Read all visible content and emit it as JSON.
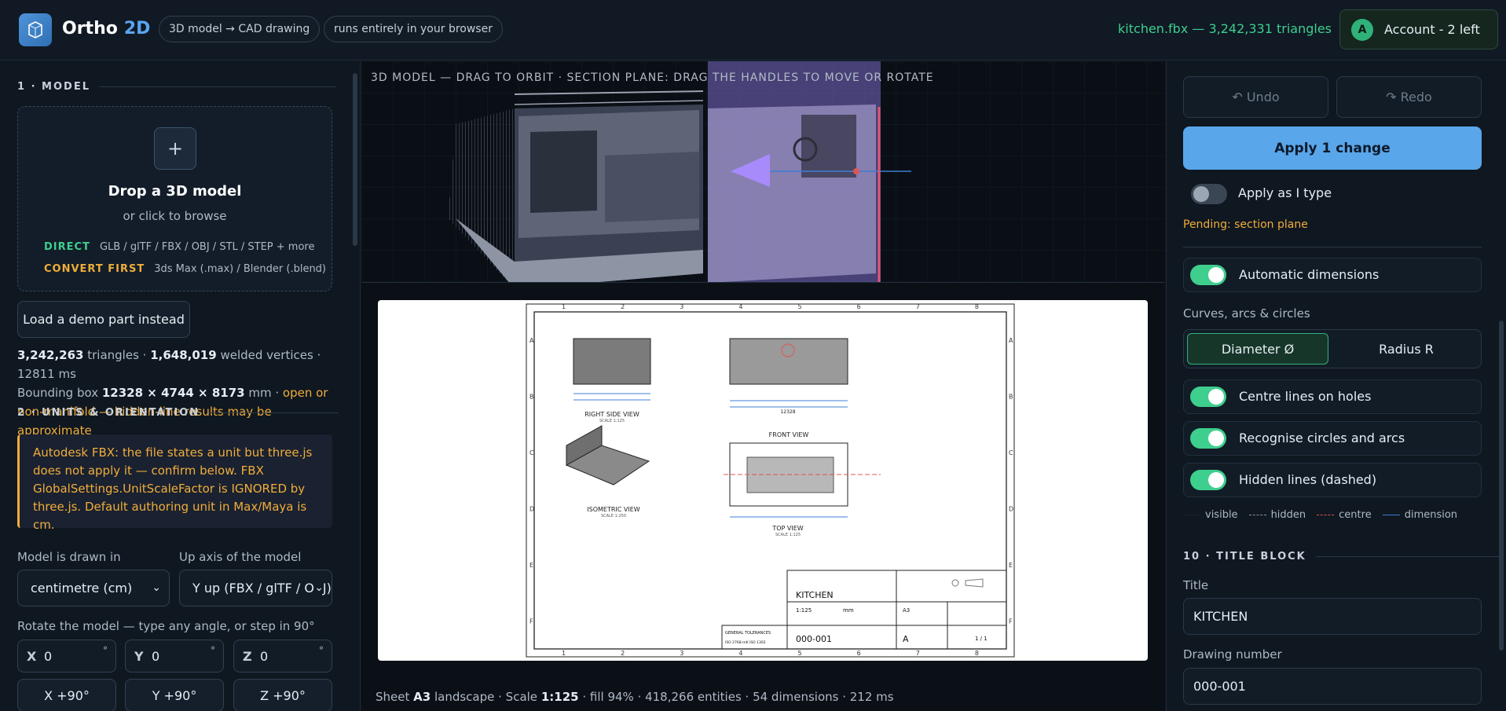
{
  "header": {
    "brand_name": "Ortho",
    "brand_accent": "2D",
    "pill_1": "3D model → CAD drawing",
    "pill_2": "runs entirely in your browser",
    "file_info": "kitchen.fbx — 3,242,331 triangles",
    "account_initial": "A",
    "account_label": "Account - 2 left"
  },
  "model": {
    "section_title": "1 · MODEL",
    "drop_plus": "+",
    "drop_title": "Drop a 3D model",
    "drop_sub": "or click to browse",
    "direct_key": "DIRECT",
    "direct_formats": "GLB / glTF / FBX / OBJ / STL / STEP + more",
    "convert_key": "CONVERT FIRST",
    "convert_formats": "3ds Max (.max) / Blender (.blend)",
    "demo_button": "Load a demo part instead",
    "stats": {
      "triangles": "3,242,263",
      "triangles_label": "triangles ·",
      "vertices": "1,648,019",
      "vertices_label": "welded vertices · 12811 ms",
      "bbox_label": "Bounding box",
      "bbox": "12328 × 4744 × 8173",
      "bbox_unit": "mm ·",
      "warning": "open or non-manifold — hidden-line results may be approximate"
    }
  },
  "units": {
    "section_title": "2 · UNITS & ORIENTATION",
    "notice": "Autodesk FBX: the file states a unit but three.js does not apply it — confirm below. FBX GlobalSettings.UnitScaleFactor is IGNORED by three.js. Default authoring unit in Max/Maya is cm.",
    "drawn_in_label": "Model is drawn in",
    "drawn_in_value": "centimetre (cm)",
    "up_axis_label": "Up axis of the model",
    "up_axis_value": "Y up (FBX / glTF / OBJ)",
    "rotate_label": "Rotate the model — type any angle, or step in 90°",
    "x_label": "X",
    "x_value": "0",
    "y_label": "Y",
    "y_value": "0",
    "z_label": "Z",
    "z_value": "0",
    "deg": "°",
    "x_step": "X +90°",
    "y_step": "Y +90°",
    "z_step": "Z +90°"
  },
  "viewport": {
    "caption": "3D MODEL — DRAG TO ORBIT · SECTION PLANE: DRAG THE HANDLES TO MOVE OR ROTATE"
  },
  "sheet": {
    "col_numbers": [
      "1",
      "2",
      "3",
      "4",
      "5",
      "6",
      "7",
      "8"
    ],
    "row_letters": [
      "A",
      "B",
      "C",
      "D",
      "E",
      "F"
    ],
    "view_right": "RIGHT SIDE VIEW",
    "view_right_scale": "SCALE 1:125",
    "view_front": "FRONT VIEW",
    "view_iso": "ISOMETRIC VIEW",
    "view_iso_scale": "SCALE 1:250",
    "view_top": "TOP VIEW",
    "view_top_scale": "SCALE 1:125",
    "dim_12328": "12328",
    "tb_title": "KITCHEN",
    "tb_scale": "1:125",
    "tb_unit": "mm",
    "tb_size": "A3",
    "tb_number": "000-001",
    "tb_rev": "A",
    "tb_sheet": "1 / 1",
    "tb_tolerances": "GENERAL TOLERANCES",
    "tb_iso": "ISO 2768-mK ISO 1302",
    "caption_prefix": "Sheet",
    "caption_size": "A3",
    "caption_mid": "landscape · Scale",
    "caption_scale": "1:125",
    "caption_rest": "· fill 94% · 418,266 entities · 54 dimensions · 212 ms"
  },
  "right": {
    "undo": "↶ Undo",
    "redo": "↷ Redo",
    "apply": "Apply 1 change",
    "apply_as_type": "Apply as I type",
    "pending": "Pending: section plane",
    "auto_dims": "Automatic dimensions",
    "curves_label": "Curves, arcs & circles",
    "diameter": "Diameter Ø",
    "radius": "Radius R",
    "centre_lines": "Centre lines on holes",
    "recognise": "Recognise circles and arcs",
    "hidden_lines": "Hidden lines (dashed)",
    "legend_visible": "visible",
    "legend_hidden": "hidden",
    "legend_centre": "centre",
    "legend_dimension": "dimension",
    "title_block_section": "10 · TITLE BLOCK",
    "title_label": "Title",
    "title_value": "KITCHEN",
    "drawing_number_label": "Drawing number",
    "drawing_number_value": "000-001"
  },
  "colors": {
    "accent_green": "#3ecf8e",
    "accent_blue": "#5aa6ea",
    "warning_orange": "#f0ad3b",
    "hidden_line": "#8b95a1",
    "centre_line": "#e05555",
    "dimension_line": "#3f7fd6"
  }
}
